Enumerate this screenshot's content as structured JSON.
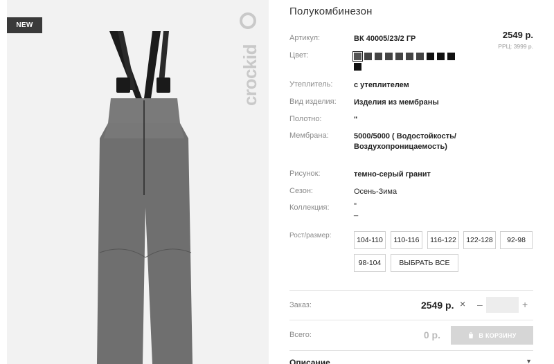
{
  "badge": {
    "label": "NEW"
  },
  "brand": {
    "logo_text": "crockid"
  },
  "product": {
    "title": "Полукомбинезон",
    "price": "2549 р.",
    "rrp": "РРЦ: 3999 р."
  },
  "attributes": [
    {
      "label": "Артикул:",
      "value": "ВК 40005/23/2 ГР"
    },
    {
      "label": "Цвет:",
      "value": ""
    },
    {
      "label": "Утеплитель:",
      "value": "с утеплителем"
    },
    {
      "label": "Вид изделия:",
      "value": "Изделия из мембраны"
    },
    {
      "label": "Полотно:",
      "value": "\""
    },
    {
      "label": "Мембрана:",
      "value": "5000/5000 ( Водостойкость/ Воздухопроницаемость)"
    },
    {
      "label": "Рисунок:",
      "value": "темно-серый гранит"
    },
    {
      "label": "Сезон:",
      "value": "Осень-Зима"
    },
    {
      "label": "Коллекция:",
      "value": "\"\n_"
    },
    {
      "label": "Рост/размер:",
      "value": ""
    }
  ],
  "colors": {
    "swatches": [
      "selected",
      "gray",
      "gray",
      "gray",
      "gray",
      "gray",
      "gray",
      "dark",
      "dark",
      "dark",
      "dark"
    ],
    "swatch_gray": "#444444",
    "swatch_dark": "#111111"
  },
  "sizes": {
    "options": [
      "104-110",
      "110-116",
      "116-122",
      "122-128",
      "92-98",
      "98-104"
    ],
    "select_all": "ВЫБРАТЬ ВСЕ"
  },
  "order": {
    "label": "Заказ:",
    "price": "2549 р.",
    "times_symbol": "×",
    "minus_symbol": "–",
    "plus_symbol": "+",
    "quantity": ""
  },
  "total": {
    "label": "Всего:",
    "value": "0 р.",
    "cart_button": "В КОРЗИНУ"
  },
  "description": {
    "title": "Описание"
  }
}
